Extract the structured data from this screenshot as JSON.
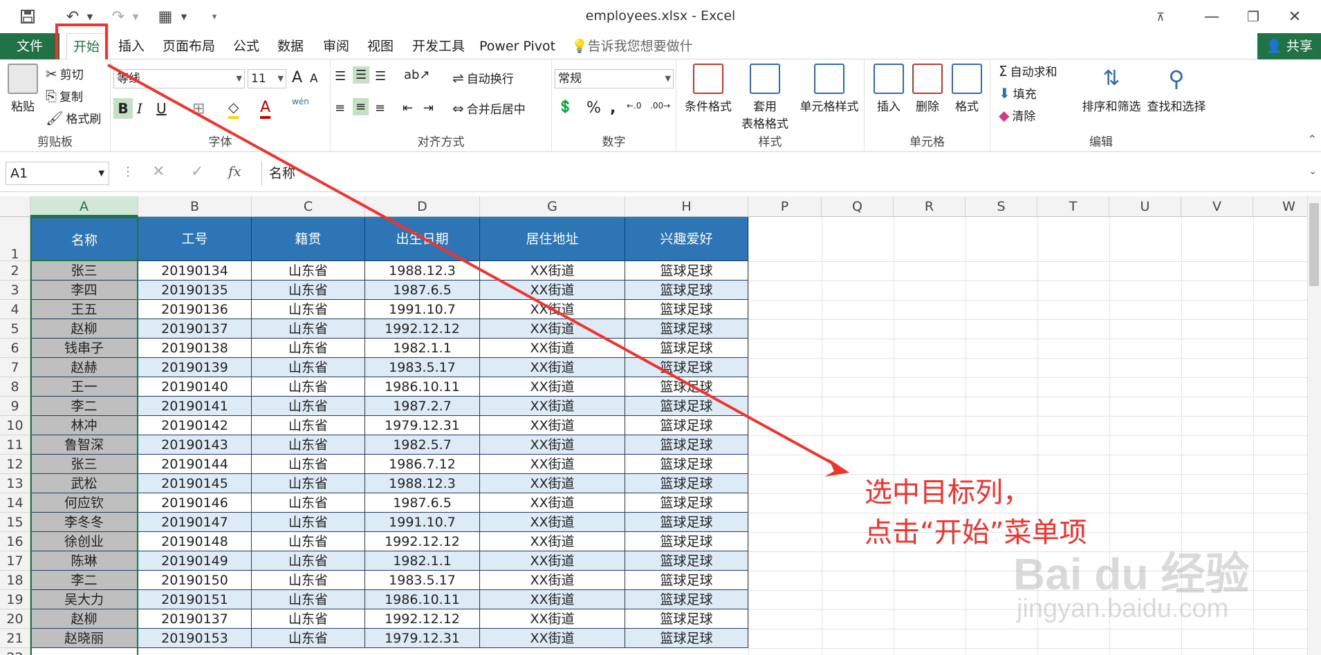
{
  "window": {
    "title": "employees.xlsx - Excel"
  },
  "tabs": {
    "file": "文件",
    "home": "开始",
    "insert": "插入",
    "page_layout": "页面布局",
    "formulas": "公式",
    "data": "数据",
    "review": "审阅",
    "view": "视图",
    "developer": "开发工具",
    "power_pivot": "Power Pivot",
    "tell_me": "告诉我您想要做什么...",
    "share": "共享"
  },
  "ribbon": {
    "clipboard": {
      "label": "剪贴板",
      "paste": "粘贴",
      "cut": "剪切",
      "copy": "复制",
      "format_painter": "格式刷"
    },
    "font": {
      "label": "字体",
      "name": "等线",
      "size": "11",
      "phonetic": "wén"
    },
    "alignment": {
      "label": "对齐方式",
      "wrap": "自动换行",
      "merge": "合并后居中"
    },
    "number": {
      "label": "数字",
      "format": "常规"
    },
    "styles": {
      "label": "样式",
      "conditional": "条件格式",
      "table_l1": "套用",
      "table_l2": "表格格式",
      "cell_styles": "单元格样式"
    },
    "cells": {
      "label": "单元格",
      "insert": "插入",
      "delete": "删除",
      "format": "格式"
    },
    "editing": {
      "label": "编辑",
      "autosum": "自动求和",
      "fill": "填充",
      "clear": "清除",
      "sort": "排序和筛选",
      "find": "查找和选择"
    }
  },
  "formula_bar": {
    "name_box": "A1",
    "fx": "fx",
    "value": "名称"
  },
  "sheet": {
    "col_headers": [
      "A",
      "B",
      "C",
      "D",
      "G",
      "H",
      "P",
      "Q",
      "R",
      "S",
      "T",
      "U",
      "V",
      "W"
    ],
    "table_headers": [
      "名称",
      "工号",
      "籍贯",
      "出生日期",
      "居住地址",
      "兴趣爱好"
    ],
    "rows": [
      [
        "张三",
        "20190134",
        "山东省",
        "1988.12.3",
        "XX街道",
        "篮球足球"
      ],
      [
        "李四",
        "20190135",
        "山东省",
        "1987.6.5",
        "XX街道",
        "篮球足球"
      ],
      [
        "王五",
        "20190136",
        "山东省",
        "1991.10.7",
        "XX街道",
        "篮球足球"
      ],
      [
        "赵柳",
        "20190137",
        "山东省",
        "1992.12.12",
        "XX街道",
        "篮球足球"
      ],
      [
        "钱串子",
        "20190138",
        "山东省",
        "1982.1.1",
        "XX街道",
        "篮球足球"
      ],
      [
        "赵赫",
        "20190139",
        "山东省",
        "1983.5.17",
        "XX街道",
        "篮球足球"
      ],
      [
        "王一",
        "20190140",
        "山东省",
        "1986.10.11",
        "XX街道",
        "篮球足球"
      ],
      [
        "李二",
        "20190141",
        "山东省",
        "1987.2.7",
        "XX街道",
        "篮球足球"
      ],
      [
        "林冲",
        "20190142",
        "山东省",
        "1979.12.31",
        "XX街道",
        "篮球足球"
      ],
      [
        "鲁智深",
        "20190143",
        "山东省",
        "1982.5.7",
        "XX街道",
        "篮球足球"
      ],
      [
        "张三",
        "20190144",
        "山东省",
        "1986.7.12",
        "XX街道",
        "篮球足球"
      ],
      [
        "武松",
        "20190145",
        "山东省",
        "1988.12.3",
        "XX街道",
        "篮球足球"
      ],
      [
        "何应钦",
        "20190146",
        "山东省",
        "1987.6.5",
        "XX街道",
        "篮球足球"
      ],
      [
        "李冬冬",
        "20190147",
        "山东省",
        "1991.10.7",
        "XX街道",
        "篮球足球"
      ],
      [
        "徐创业",
        "20190148",
        "山东省",
        "1992.12.12",
        "XX街道",
        "篮球足球"
      ],
      [
        "陈琳",
        "20190149",
        "山东省",
        "1982.1.1",
        "XX街道",
        "篮球足球"
      ],
      [
        "李二",
        "20190150",
        "山东省",
        "1983.5.17",
        "XX街道",
        "篮球足球"
      ],
      [
        "吴大力",
        "20190151",
        "山东省",
        "1986.10.11",
        "XX街道",
        "篮球足球"
      ],
      [
        "赵柳",
        "20190137",
        "山东省",
        "1992.12.12",
        "XX街道",
        "篮球足球"
      ],
      [
        "赵晓丽",
        "20190153",
        "山东省",
        "1979.12.31",
        "XX街道",
        "篮球足球"
      ]
    ]
  },
  "annotation": {
    "line1": "选中目标列，",
    "line2": "点击“开始”菜单项"
  },
  "watermark": {
    "brand": "Bai du 经验",
    "url": "jingyan.baidu.com"
  },
  "colors": {
    "excel_green": "#217346",
    "header_blue": "#2e75b6",
    "row_alt": "#ddebf7",
    "col_a": "#bfbfbf",
    "annotation_red": "#f2332d"
  }
}
